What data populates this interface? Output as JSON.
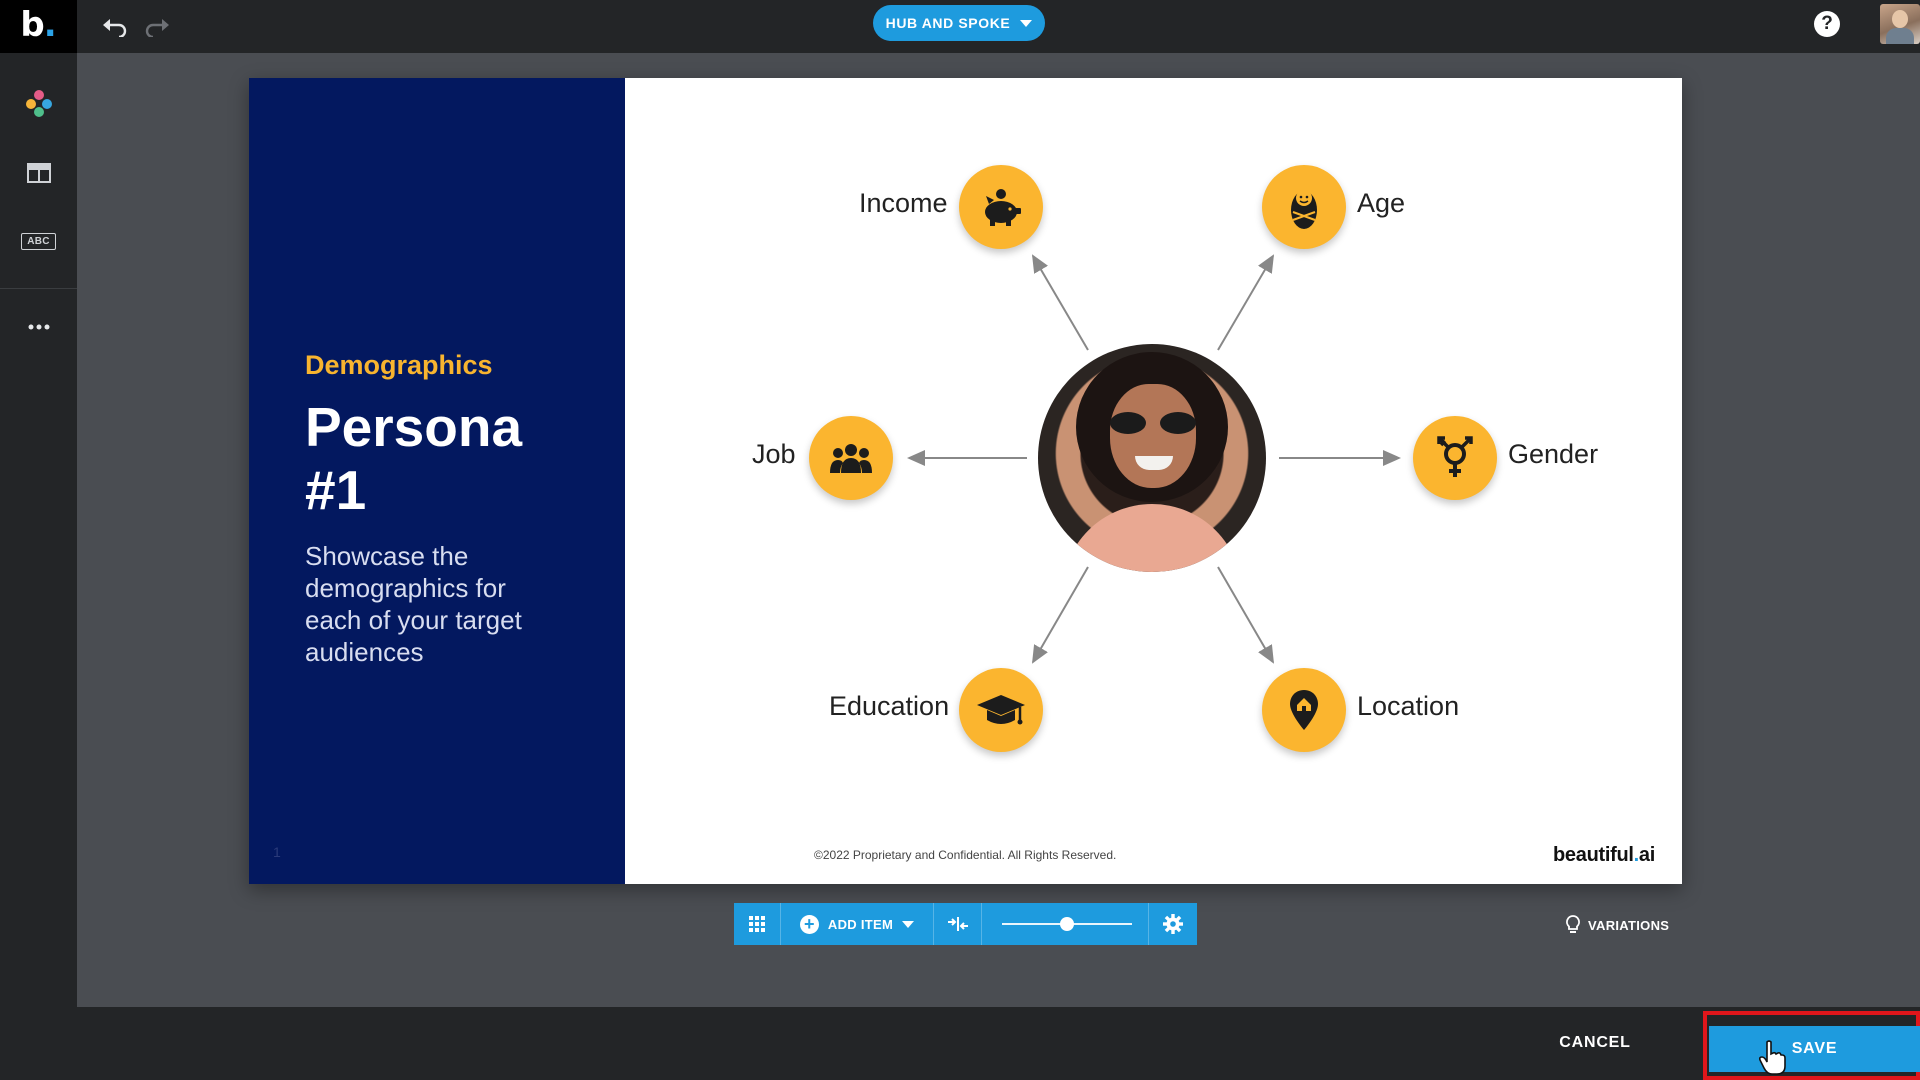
{
  "app": {
    "logo_text": "b",
    "logo_dot": "."
  },
  "topbar": {
    "layout_label": "HUB AND SPOKE",
    "help_label": "?"
  },
  "sidebar": {
    "items": [
      {
        "icon": "theme-palette-icon"
      },
      {
        "icon": "layout-icon"
      },
      {
        "icon": "text-style-icon",
        "label": "ABC"
      },
      {
        "icon": "more-icon"
      }
    ]
  },
  "slide": {
    "eyebrow": "Demographics",
    "title_line1": "Persona",
    "title_line2": "#1",
    "subtitle": "Showcase the demographics for each of your target audiences",
    "slide_number": "1",
    "nodes": [
      {
        "label": "Income",
        "icon": "piggy-bank-icon"
      },
      {
        "label": "Age",
        "icon": "baby-icon"
      },
      {
        "label": "Job",
        "icon": "people-icon"
      },
      {
        "label": "Gender",
        "icon": "gender-icon"
      },
      {
        "label": "Education",
        "icon": "graduation-cap-icon"
      },
      {
        "label": "Location",
        "icon": "map-pin-icon"
      }
    ],
    "footer": "©2022 Proprietary and Confidential. All Rights Reserved.",
    "brand_main": "beautiful",
    "brand_dot": ".",
    "brand_suffix": "ai"
  },
  "element_toolbar": {
    "add_item_label": "ADD ITEM",
    "size_slider_value": 0.5
  },
  "variations_label": "VARIATIONS",
  "bottombar": {
    "cancel_label": "CANCEL",
    "save_label": "SAVE"
  },
  "colors": {
    "accent": "#1e9bde",
    "node": "#fbb52f",
    "panel": "#03185f",
    "highlight": "#e0161b"
  }
}
